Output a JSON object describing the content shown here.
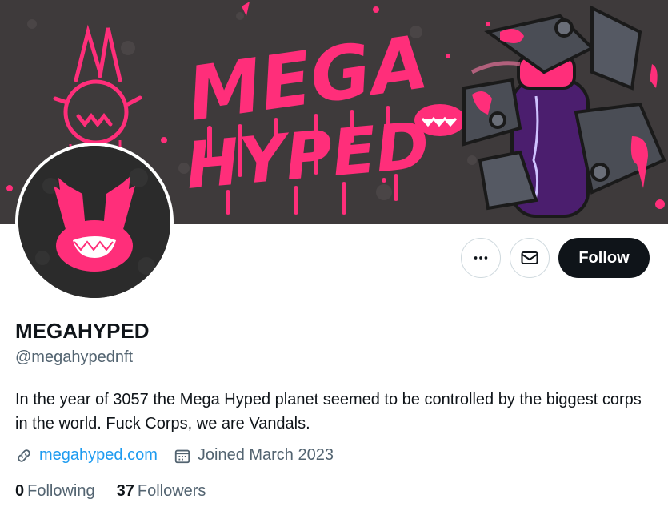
{
  "banner": {
    "colors": {
      "bg": "#3d3a3a",
      "pink": "#ff2e7a",
      "purple": "#4b1e6e",
      "metal": "#4a4d55"
    }
  },
  "profile": {
    "display_name": "MEGAHYPED",
    "handle": "@megahypednft",
    "bio": "In the year of 3057 the Mega Hyped planet seemed to be controlled by the biggest corps in the world. Fuck Corps, we are Vandals.",
    "website": "megahyped.com",
    "joined": "Joined March 2023",
    "following_count": "0",
    "following_label": "Following",
    "followers_count": "37",
    "followers_label": "Followers"
  },
  "actions": {
    "follow_label": "Follow",
    "more_icon": "more-horizontal-icon",
    "message_icon": "envelope-icon"
  },
  "colors": {
    "accent": "#1d9bf0",
    "text": "#0f1419",
    "muted": "#536471",
    "border": "#cfd9de"
  }
}
